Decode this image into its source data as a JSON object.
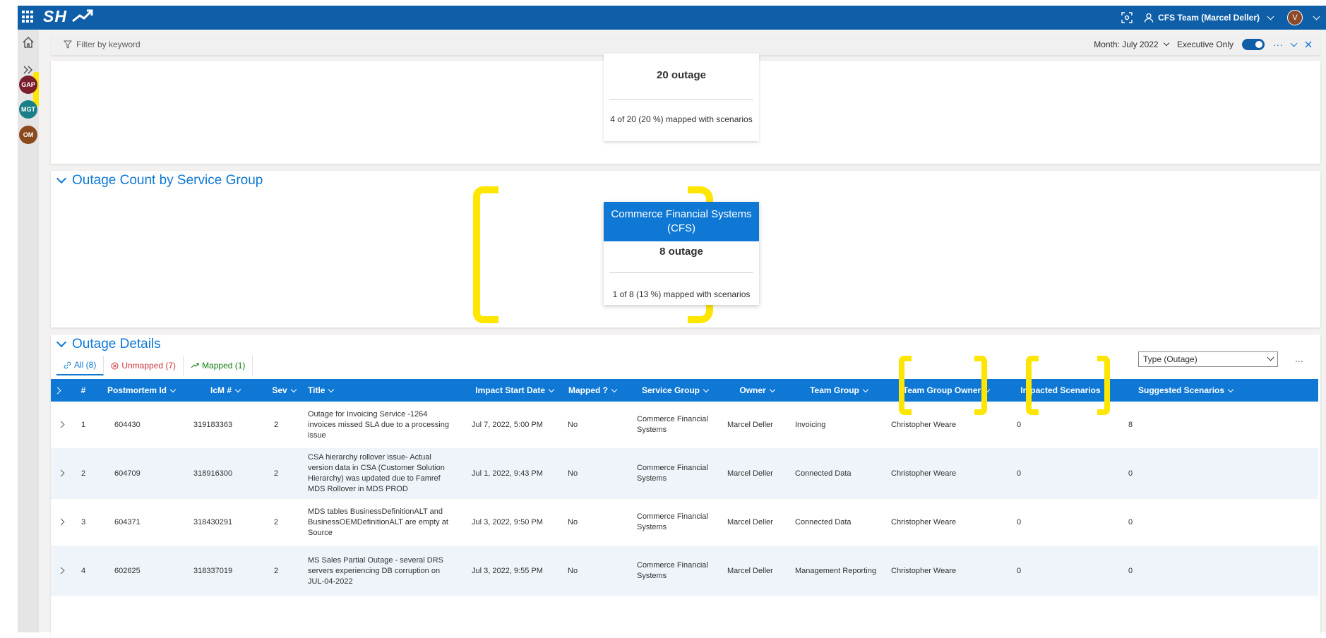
{
  "suite": {
    "logo": "SH",
    "team_label": "CFS Team (Marcel Deller)",
    "avatar_letter": "V"
  },
  "rail": {
    "items": [
      "GAP",
      "MGT",
      "OM"
    ],
    "colors": {
      "GAP": "#7A1E2E",
      "MGT": "#1A7F86",
      "OM": "#8B4A1E"
    }
  },
  "filterbar": {
    "keyword_placeholder": "Filter by keyword",
    "month_label": "Month: July 2022",
    "executive_only_label": "Executive Only",
    "more": "···"
  },
  "top_tile": {
    "count": "20 outage",
    "mapped": "4 of 20 (20 %) mapped with scenarios"
  },
  "service_group_section": {
    "title": "Outage Count by Service Group",
    "tile": {
      "name": "Commerce Financial Systems (CFS)",
      "count": "8 outage",
      "mapped": "1 of 8 (13 %) mapped with scenarios"
    }
  },
  "details_section": {
    "title": "Outage Details",
    "tabs": [
      {
        "label": "All (8)",
        "color": "#0F78D4"
      },
      {
        "label": "Unmapped (7)",
        "color": "#d13438"
      },
      {
        "label": "Mapped (1)",
        "color": "#107C10"
      }
    ],
    "type_select": "Type (Outage)",
    "more": "...",
    "columns": [
      "#",
      "Postmortem Id",
      "IcM #",
      "Sev",
      "Title",
      "Impact Start Date",
      "Mapped ?",
      "Service Group",
      "Owner",
      "Team Group",
      "Team Group Owner",
      "Impacted Scenarios",
      "Suggested Scenarios"
    ],
    "rows": [
      {
        "num": "1",
        "postmortem": "604430",
        "icm": "319183363",
        "sev": "2",
        "title": "Outage for Invoicing Service -1264 invoices missed SLA due to a processing issue",
        "date": "Jul 7, 2022, 5:00 PM",
        "mapped": "No",
        "service_group": "Commerce Financial Systems",
        "owner": "Marcel Deller",
        "team_group": "Invoicing",
        "team_owner": "Christopher Weare",
        "impacted": "0",
        "suggested": "8"
      },
      {
        "num": "2",
        "postmortem": "604709",
        "icm": "318916300",
        "sev": "2",
        "title": "CSA hierarchy rollover issue- Actual version data in CSA (Customer Solution Hierarchy) was updated due to Famref MDS Rollover in MDS PROD",
        "date": "Jul 1, 2022, 9:43 PM",
        "mapped": "No",
        "service_group": "Commerce Financial Systems",
        "owner": "Marcel Deller",
        "team_group": "Connected Data",
        "team_owner": "Christopher Weare",
        "impacted": "0",
        "suggested": "0"
      },
      {
        "num": "3",
        "postmortem": "604371",
        "icm": "318430291",
        "sev": "2",
        "title": "MDS tables BusinessDefinitionALT and BusinessOEMDefinitionALT are empty at Source",
        "date": "Jul 3, 2022, 9:50 PM",
        "mapped": "No",
        "service_group": "Commerce Financial Systems",
        "owner": "Marcel Deller",
        "team_group": "Connected Data",
        "team_owner": "Christopher Weare",
        "impacted": "0",
        "suggested": "0"
      },
      {
        "num": "4",
        "postmortem": "602625",
        "icm": "318337019",
        "sev": "2",
        "title": "MS Sales Partial Outage - several DRS servers experiencing DB corruption on JUL-04-2022",
        "date": "Jul 3, 2022, 9:55 PM",
        "mapped": "No",
        "service_group": "Commerce Financial Systems",
        "owner": "Marcel Deller",
        "team_group": "Management Reporting",
        "team_owner": "Christopher Weare",
        "impacted": "0",
        "suggested": "0"
      }
    ]
  }
}
